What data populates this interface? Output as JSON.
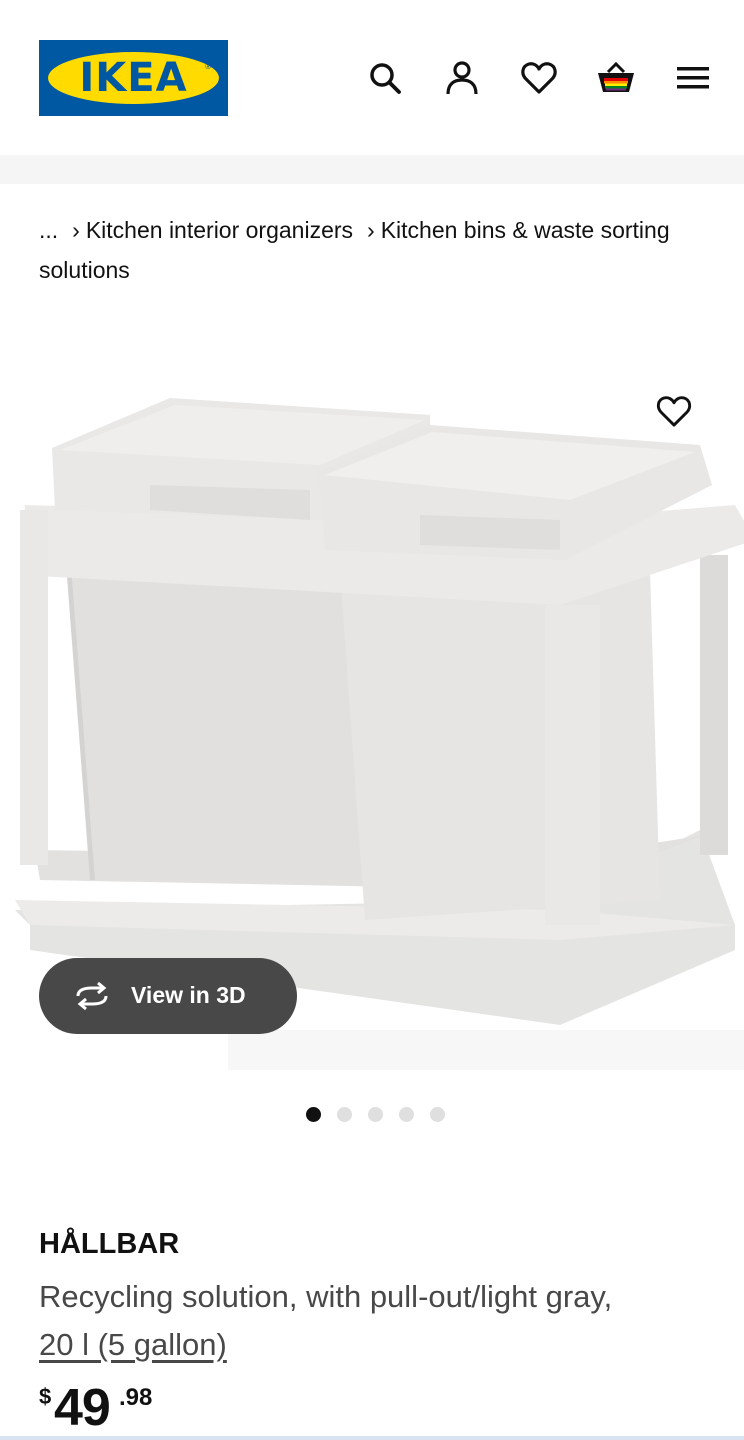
{
  "header": {
    "logo_text": "IKEA",
    "logo_reg": "®",
    "icons": [
      "search-icon",
      "account-icon",
      "wishlist-heart-icon",
      "shopping-bag-icon",
      "hamburger-menu-icon"
    ],
    "colors": {
      "brand_blue": "#0058a3",
      "brand_yellow": "#ffdb00"
    }
  },
  "breadcrumb": {
    "ellipsis": "...",
    "items": [
      {
        "label": "Kitchen interior organizers"
      },
      {
        "label": "Kitchen bins & waste sorting solutions"
      }
    ]
  },
  "media": {
    "view3d_label": "View in 3D",
    "carousel_count": 5,
    "carousel_active": 1
  },
  "product": {
    "name": "HÅLLBAR",
    "description": "Recycling solution, with pull-out/light gray,",
    "size": "20 l (5 gallon)",
    "price": {
      "currency": "$",
      "integer": "49",
      "decimal": ".98"
    }
  }
}
